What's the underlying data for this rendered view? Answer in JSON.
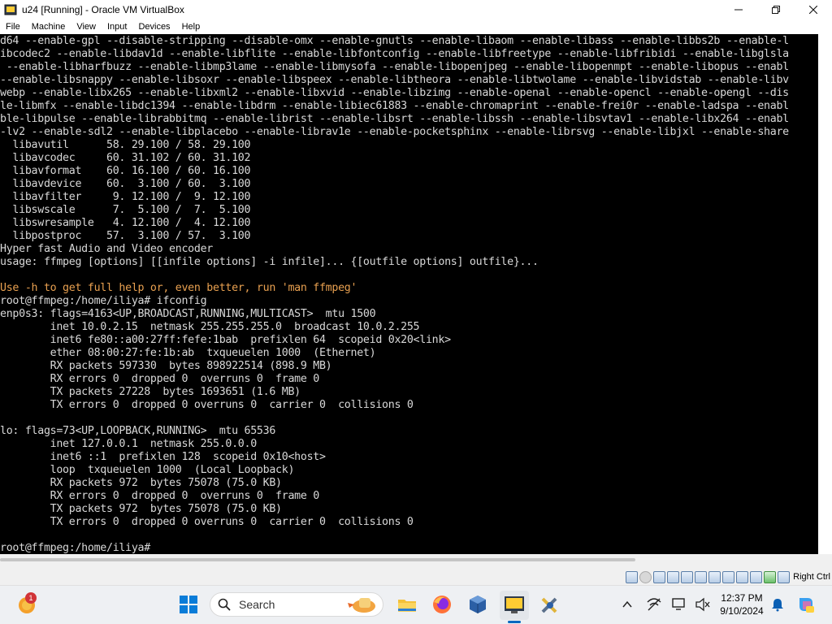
{
  "window": {
    "title": "u24 [Running] - Oracle VM VirtualBox",
    "controls": [
      "minimize-icon",
      "maximize-icon",
      "close-icon"
    ]
  },
  "menubar": {
    "items": [
      "File",
      "Machine",
      "View",
      "Input",
      "Devices",
      "Help"
    ]
  },
  "terminal": {
    "lines": [
      "d64 --enable-gpl --disable-stripping --disable-omx --enable-gnutls --enable-libaom --enable-libass --enable-libbs2b --enable-l",
      "ibcodec2 --enable-libdav1d --enable-libflite --enable-libfontconfig --enable-libfreetype --enable-libfribidi --enable-libglsla",
      " --enable-libharfbuzz --enable-libmp3lame --enable-libmysofa --enable-libopenjpeg --enable-libopenmpt --enable-libopus --enabl",
      "--enable-libsnappy --enable-libsoxr --enable-libspeex --enable-libtheora --enable-libtwolame --enable-libvidstab --enable-libv",
      "webp --enable-libx265 --enable-libxml2 --enable-libxvid --enable-libzimg --enable-openal --enable-opencl --enable-opengl --dis",
      "le-libmfx --enable-libdc1394 --enable-libdrm --enable-libiec61883 --enable-chromaprint --enable-frei0r --enable-ladspa --enabl",
      "ble-libpulse --enable-librabbitmq --enable-librist --enable-libsrt --enable-libssh --enable-libsvtav1 --enable-libx264 --enabl",
      "-lv2 --enable-sdl2 --enable-libplacebo --enable-librav1e --enable-pocketsphinx --enable-librsvg --enable-libjxl --enable-share",
      "  libavutil      58. 29.100 / 58. 29.100",
      "  libavcodec     60. 31.102 / 60. 31.102",
      "  libavformat    60. 16.100 / 60. 16.100",
      "  libavdevice    60.  3.100 / 60.  3.100",
      "  libavfilter     9. 12.100 /  9. 12.100",
      "  libswscale      7.  5.100 /  7.  5.100",
      "  libswresample   4. 12.100 /  4. 12.100",
      "  libpostproc    57.  3.100 / 57.  3.100",
      "Hyper fast Audio and Video encoder",
      "usage: ffmpeg [options] [[infile options] -i infile]... {[outfile options] outfile}...",
      "",
      "Use -h to get full help or, even better, run 'man ffmpeg'",
      "root@ffmpeg:/home/iliya# ifconfig",
      "enp0s3: flags=4163<UP,BROADCAST,RUNNING,MULTICAST>  mtu 1500",
      "        inet 10.0.2.15  netmask 255.255.255.0  broadcast 10.0.2.255",
      "        inet6 fe80::a00:27ff:fefe:1bab  prefixlen 64  scopeid 0x20<link>",
      "        ether 08:00:27:fe:1b:ab  txqueuelen 1000  (Ethernet)",
      "        RX packets 597330  bytes 898922514 (898.9 MB)",
      "        RX errors 0  dropped 0  overruns 0  frame 0",
      "        TX packets 27228  bytes 1693651 (1.6 MB)",
      "        TX errors 0  dropped 0 overruns 0  carrier 0  collisions 0",
      "",
      "lo: flags=73<UP,LOOPBACK,RUNNING>  mtu 65536",
      "        inet 127.0.0.1  netmask 255.0.0.0",
      "        inet6 ::1  prefixlen 128  scopeid 0x10<host>",
      "        loop  txqueuelen 1000  (Local Loopback)",
      "        RX packets 972  bytes 75078 (75.0 KB)",
      "        RX errors 0  dropped 0  overruns 0  frame 0",
      "        TX packets 972  bytes 75078 (75.0 KB)",
      "        TX errors 0  dropped 0 overruns 0  carrier 0  collisions 0",
      "",
      "root@ffmpeg:/home/iliya# "
    ],
    "highlight_line_index": 19,
    "highlight_color": "#e8a050",
    "text_color": "#d8d8d8",
    "background": "#000000"
  },
  "vm_status": {
    "icons": [
      "hard-disk-icon",
      "optical-drive-icon",
      "audio-icon",
      "network-icon",
      "usb-icon",
      "shared-folder-icon",
      "display-icon",
      "video-capture-icon",
      "recording-icon",
      "cpu-icon",
      "mouse-integration-icon",
      "keyboard-icon"
    ],
    "host_key": "Right Ctrl"
  },
  "taskbar": {
    "search_placeholder": "Search",
    "notification_count": "1",
    "clock_time": "12:37 PM",
    "clock_date": "9/10/2024",
    "accent": "#0067c0",
    "pinned": [
      "weather-icon",
      "start-icon",
      "search-icon",
      "widget-icon",
      "file-explorer-icon",
      "firefox-icon",
      "virtualbox-icon",
      "virtualbox-vm-icon",
      "tool-icon"
    ],
    "tray": [
      "chevron-up-icon",
      "network-off-icon",
      "display-settings-icon",
      "volume-icon",
      "notification-bell-icon",
      "copilot-icon"
    ]
  }
}
